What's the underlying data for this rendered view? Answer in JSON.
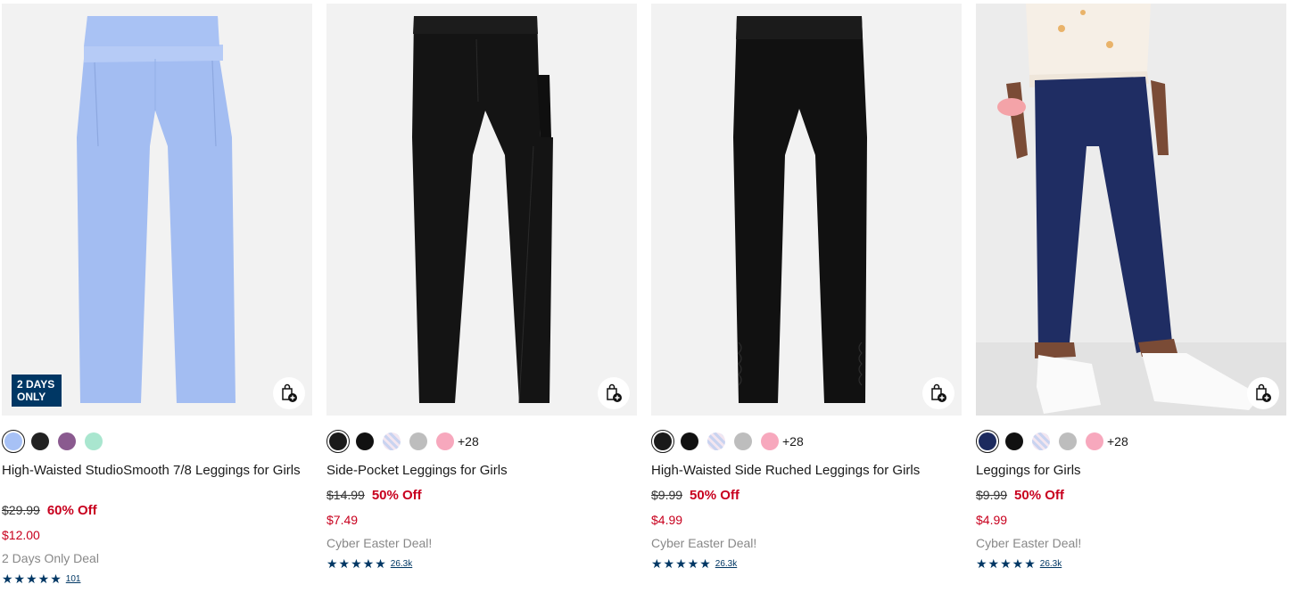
{
  "products": [
    {
      "name": "High-Waisted StudioSmooth 7/8 Leggings for Girls",
      "badge": "2 DAYS\nONLY",
      "badge_line1": "2 DAYS",
      "badge_line2": "ONLY",
      "swatches": [
        "#a7c1f5",
        "#222222",
        "#8a5a8f",
        "#a9e6cf"
      ],
      "more_colors": "",
      "original_price": "$29.99",
      "discount": "60% Off",
      "sale_price": "$12.00",
      "deal": "2 Days Only Deal",
      "stars": "★★★★★",
      "rating_count": "101"
    },
    {
      "name": "Side-Pocket Leggings for Girls",
      "swatches": [
        "#1a1a1a",
        "#111111",
        "plaid",
        "#bdbdbd",
        "#f7a8bd"
      ],
      "more_colors": "+28",
      "original_price": "$14.99",
      "discount": "50% Off",
      "sale_price": "$7.49",
      "deal": "Cyber Easter Deal!",
      "stars": "★★★★★",
      "rating_count": "26.3k"
    },
    {
      "name": "High-Waisted Side Ruched Leggings for Girls",
      "swatches": [
        "#1a1a1a",
        "#111111",
        "plaid",
        "#bdbdbd",
        "#f7a8bd"
      ],
      "more_colors": "+28",
      "original_price": "$9.99",
      "discount": "50% Off",
      "sale_price": "$4.99",
      "deal": "Cyber Easter Deal!",
      "stars": "★★★★★",
      "rating_count": "26.3k"
    },
    {
      "name": "Leggings for Girls",
      "swatches": [
        "#1c2a5e",
        "#111111",
        "plaid",
        "#bdbdbd",
        "#f7a8bd"
      ],
      "more_colors": "+28",
      "original_price": "$9.99",
      "discount": "50% Off",
      "sale_price": "$4.99",
      "deal": "Cyber Easter Deal!",
      "stars": "★★★★★",
      "rating_count": "26.3k"
    }
  ],
  "colors": {
    "sale_red": "#c8001e",
    "navy": "#003764",
    "muted": "#888888"
  },
  "icons": {
    "add_to_bag": "shopping-bag-plus-icon",
    "rating_star": "star-icon"
  }
}
